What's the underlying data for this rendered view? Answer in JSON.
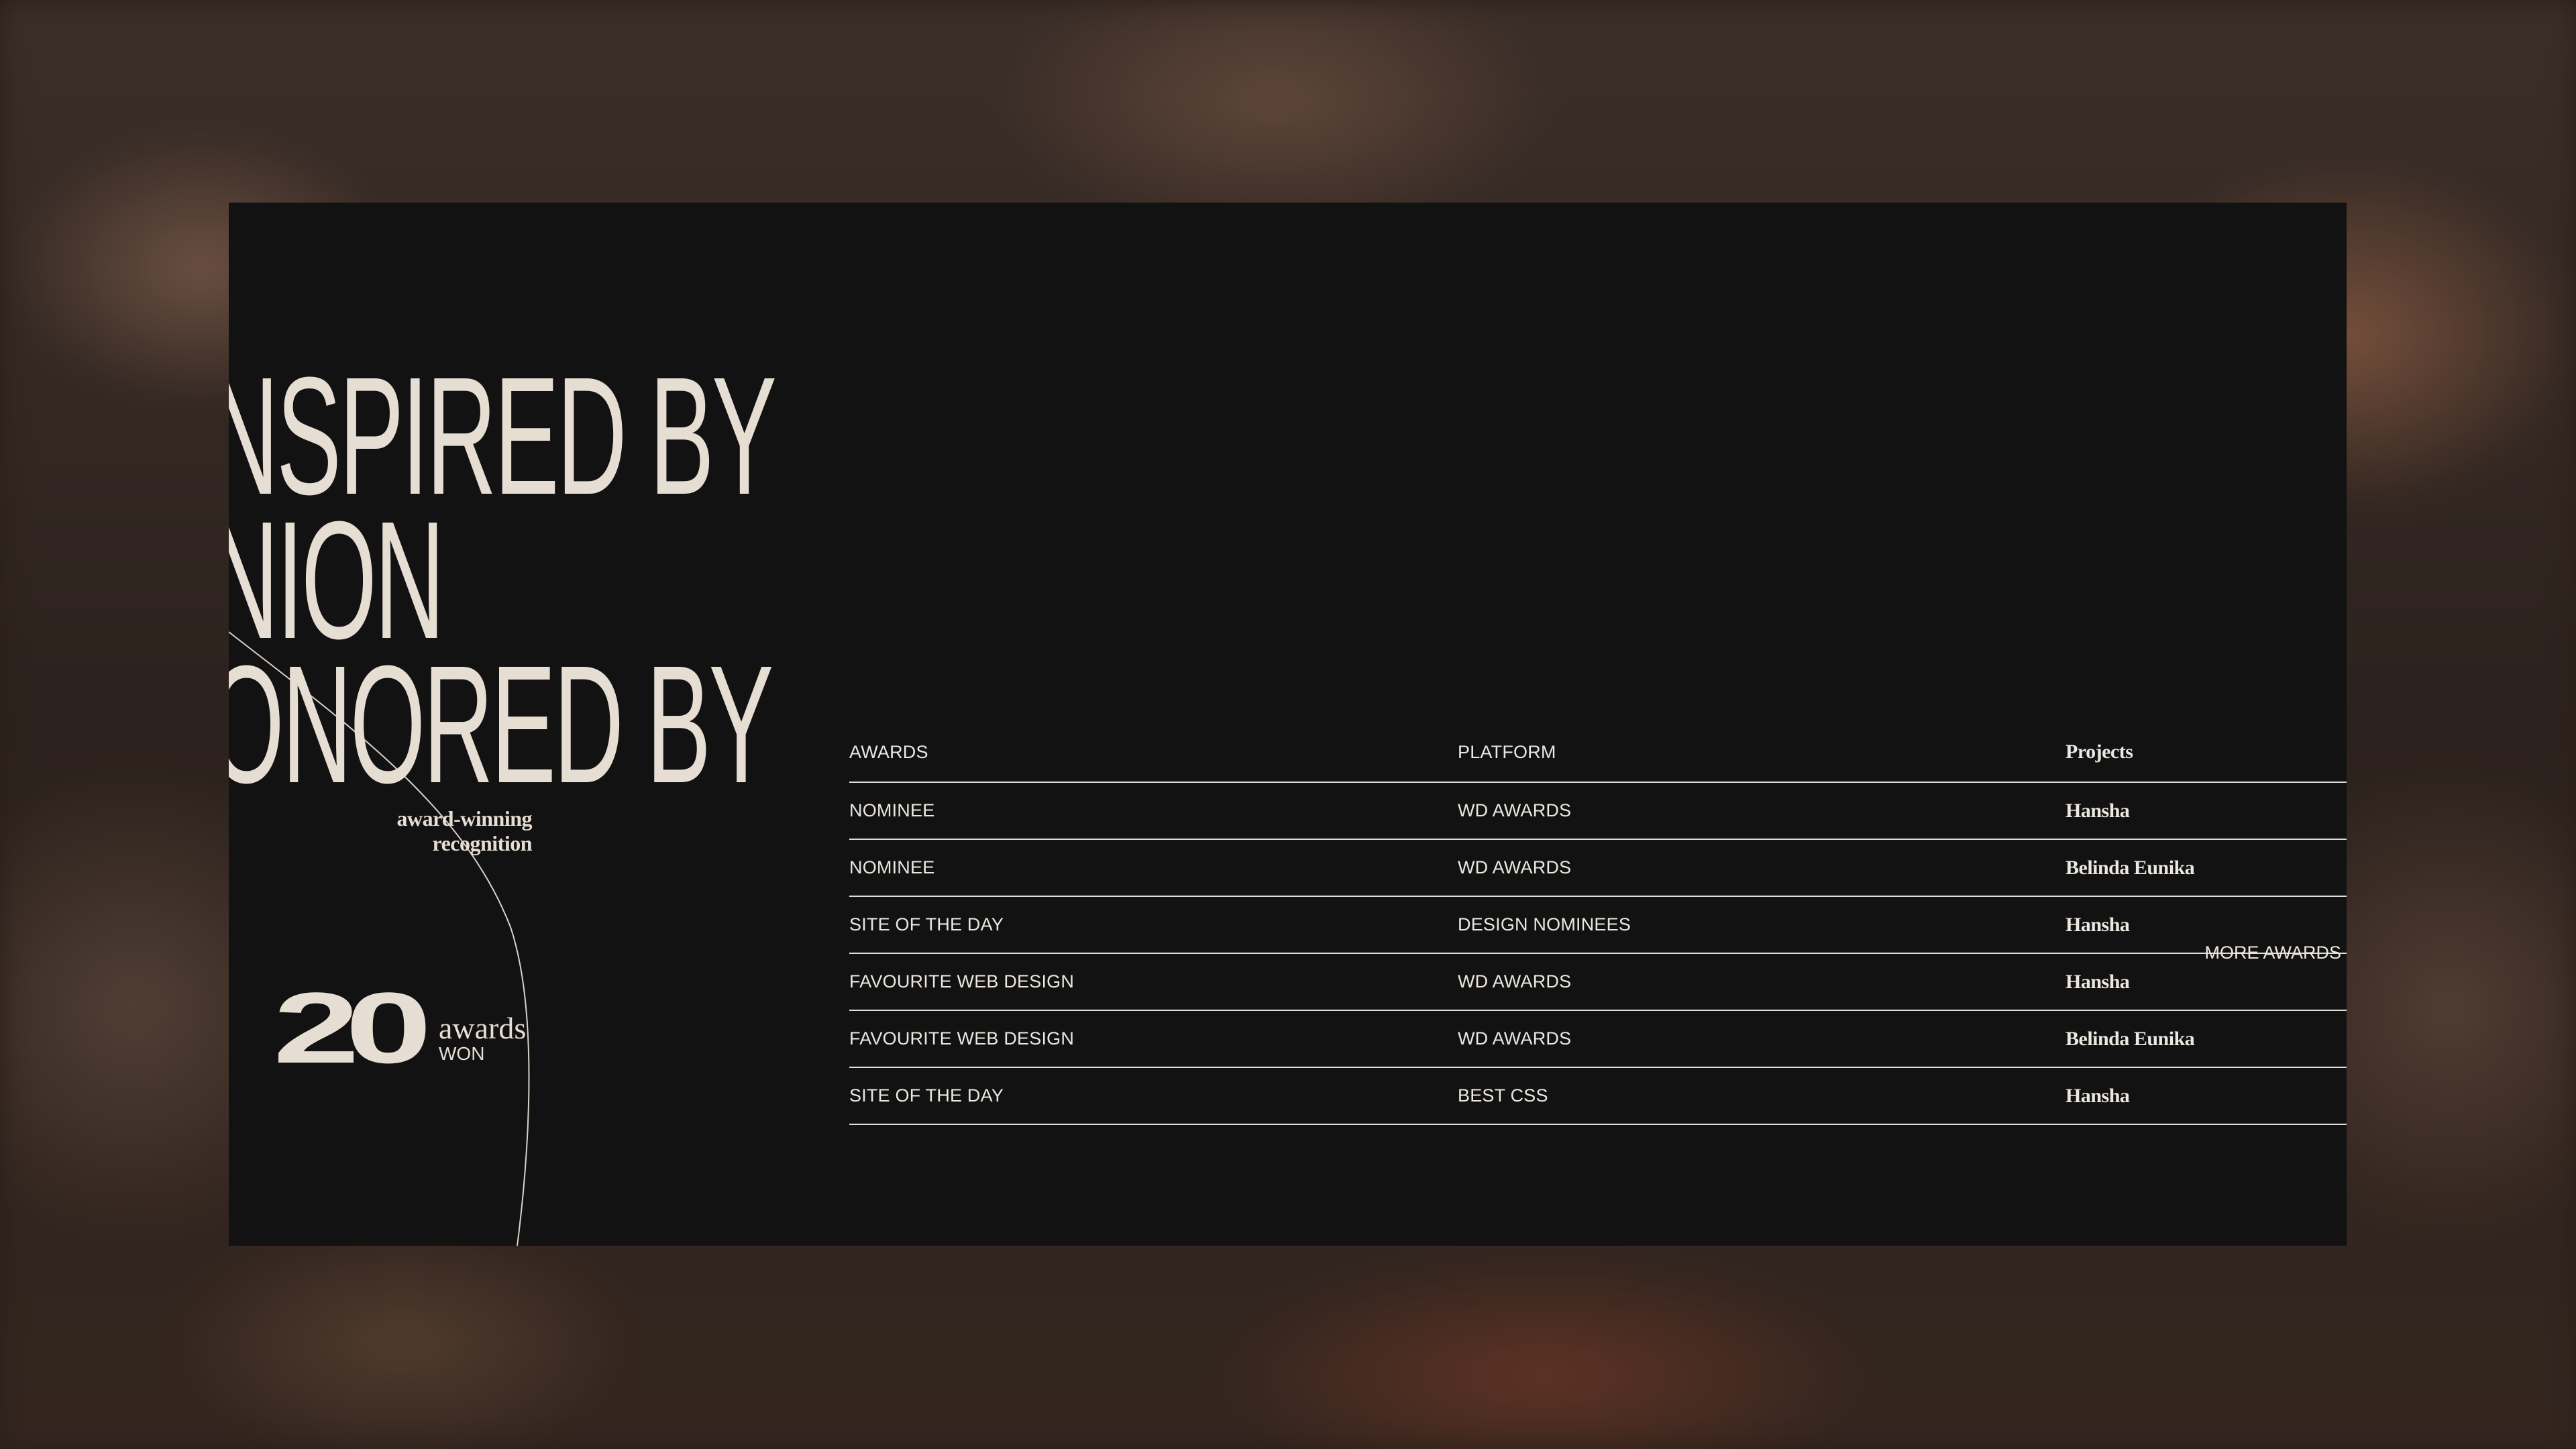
{
  "hero": {
    "line1": "NSPIRED BY",
    "line2": "NION",
    "line3": "ONORED BY",
    "subtitle": "award-winning recognition"
  },
  "counter": {
    "number": "20",
    "label": "awards",
    "sublabel": "WON"
  },
  "table": {
    "headers": {
      "awards": "AWARDS",
      "platform": "PLATFORM",
      "projects": "Projects"
    },
    "rows": [
      {
        "award": "NOMINEE",
        "platform": "WD AWARDS",
        "project": "Hansha"
      },
      {
        "award": "NOMINEE",
        "platform": "WD AWARDS",
        "project": "Belinda Eunika"
      },
      {
        "award": "SITE OF THE DAY",
        "platform": "DESIGN NOMINEES",
        "project": "Hansha"
      },
      {
        "award": "FAVOURITE WEB DESIGN",
        "platform": "WD AWARDS",
        "project": "Hansha"
      },
      {
        "award": "FAVOURITE WEB DESIGN",
        "platform": "WD AWARDS",
        "project": "Belinda Eunika"
      },
      {
        "award": "SITE OF THE DAY",
        "platform": "BEST CSS",
        "project": "Hansha"
      }
    ]
  },
  "more_awards": "MORE AWARDS",
  "colors": {
    "panel_bg": "#121212",
    "text_cream": "#e6ddd3",
    "divider": "#e2dcd4"
  }
}
